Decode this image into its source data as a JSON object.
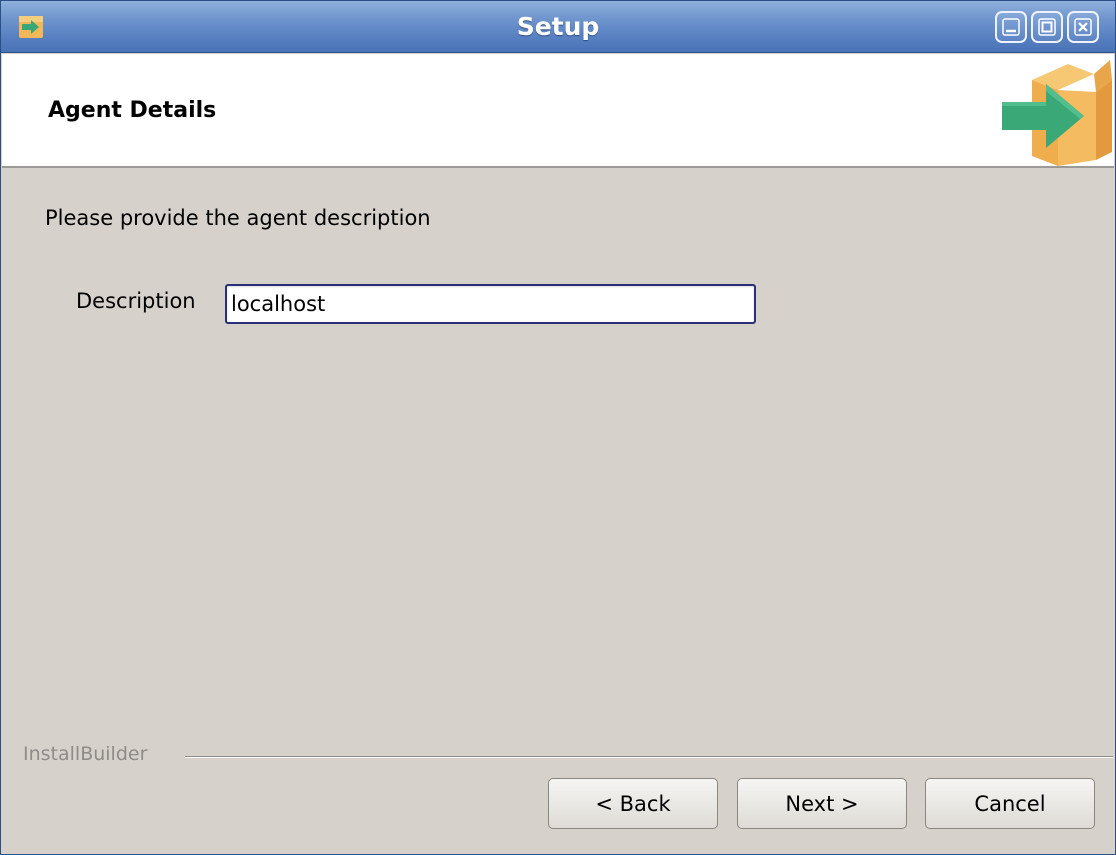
{
  "window": {
    "title": "Setup",
    "app_icon": "installer-box-arrow-icon",
    "controls": [
      "minimize-icon",
      "maximize-icon",
      "close-icon"
    ]
  },
  "header": {
    "title": "Agent Details",
    "logo_icon": "installer-box-arrow-icon"
  },
  "content": {
    "instructions": "Please provide the agent description",
    "description_label": "Description",
    "description_value": "localhost"
  },
  "footer": {
    "brand": "InstallBuilder",
    "back_label": "< Back",
    "next_label": "Next >",
    "cancel_label": "Cancel"
  },
  "colors": {
    "titlebar": "#5881c2",
    "background": "#d6d2cb",
    "header_background": "#ffffff",
    "input_border": "#2a2f7a",
    "logo_box": "#f4b95a",
    "logo_arrow": "#3aa877"
  }
}
